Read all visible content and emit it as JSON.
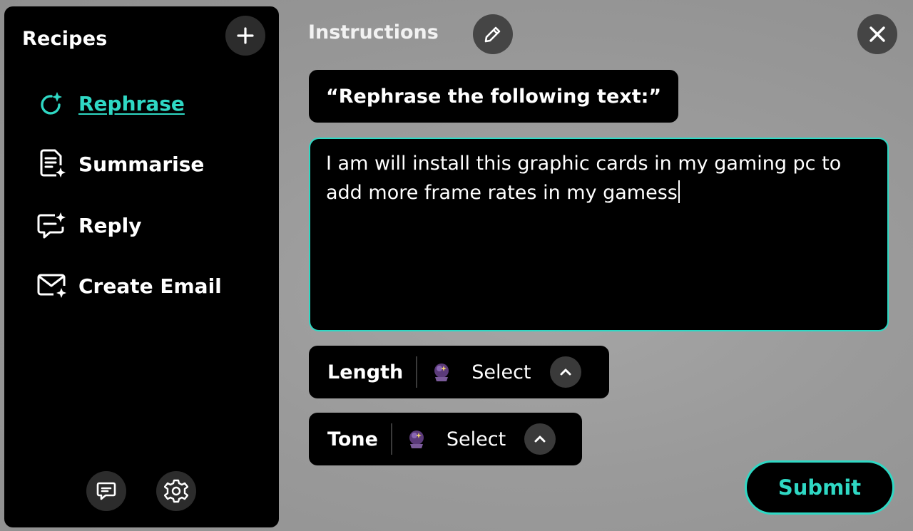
{
  "sidebar": {
    "title": "Recipes",
    "add_icon": "plus-icon",
    "items": [
      {
        "label": "Rephrase",
        "icon": "rephrase-sparkle-icon",
        "active": true
      },
      {
        "label": "Summarise",
        "icon": "document-sparkle-icon",
        "active": false
      },
      {
        "label": "Reply",
        "icon": "chat-sparkle-icon",
        "active": false
      },
      {
        "label": "Create Email",
        "icon": "mail-sparkle-icon",
        "active": false
      }
    ],
    "footer_icons": [
      "feedback-icon",
      "gear-icon"
    ]
  },
  "main": {
    "title": "Instructions",
    "edit_icon": "pencil-icon",
    "close_icon": "close-icon",
    "prompt": "“Rephrase the following text:”",
    "input_text": "I am will install this graphic cards in my gaming pc to add more frame rates in my gamess",
    "params": [
      {
        "label": "Length",
        "value": "Select",
        "icon": "crystal-ball-icon",
        "chevron": "chevron-up-icon"
      },
      {
        "label": "Tone",
        "value": "Select",
        "icon": "crystal-ball-icon",
        "chevron": "chevron-up-icon"
      }
    ],
    "submit_label": "Submit"
  },
  "colors": {
    "accent": "#2fd8c4",
    "panel": "#000000",
    "background": "#9c9c9c",
    "icon_button": "#454545"
  }
}
